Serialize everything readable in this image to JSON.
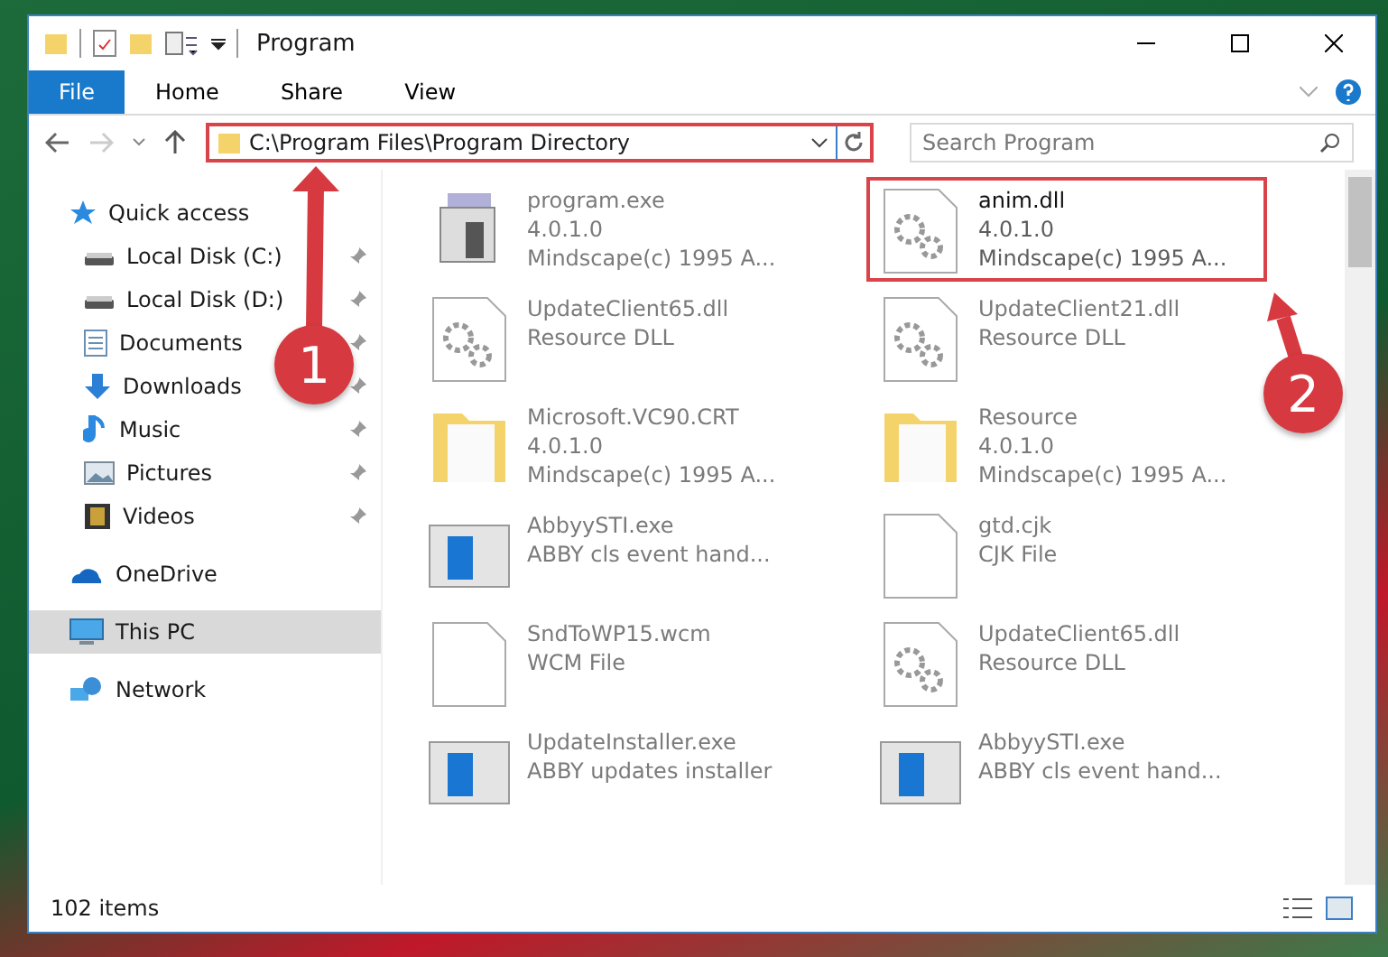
{
  "window": {
    "title": "Program"
  },
  "ribbon": {
    "file_tab": "File",
    "tabs": [
      "Home",
      "Share",
      "View"
    ]
  },
  "address": {
    "path": "C:\\Program Files\\Program Directory"
  },
  "search": {
    "placeholder": "Search Program"
  },
  "nav": [
    {
      "label": "Quick access",
      "kind": "star",
      "selected": false,
      "children": [
        {
          "label": "Local Disk (C:)",
          "kind": "drive",
          "selected": false,
          "pinned": true
        },
        {
          "label": "Local Disk (D:)",
          "kind": "drive",
          "selected": false,
          "pinned": true
        },
        {
          "label": "Documents",
          "kind": "document",
          "selected": false,
          "pinned": true
        },
        {
          "label": "Downloads",
          "kind": "download",
          "selected": false,
          "pinned": true
        },
        {
          "label": "Music",
          "kind": "music",
          "selected": false,
          "pinned": true
        },
        {
          "label": "Pictures",
          "kind": "picture",
          "selected": false,
          "pinned": true
        },
        {
          "label": "Videos",
          "kind": "video",
          "selected": false,
          "pinned": true
        }
      ]
    },
    {
      "label": "OneDrive",
      "kind": "cloud",
      "selected": false
    },
    {
      "label": "This PC",
      "kind": "computer",
      "selected": true
    },
    {
      "label": "Network",
      "kind": "network",
      "selected": false
    }
  ],
  "files": [
    {
      "kind": "app",
      "name": "program.exe",
      "details": [
        "4.0.1.0",
        "Mindscape(c) 1995 A..."
      ],
      "highlighted": false,
      "blurred": true
    },
    {
      "kind": "dll",
      "name": "anim.dll",
      "details": [
        "4.0.1.0",
        "Mindscape(c) 1995 A..."
      ],
      "highlighted": true,
      "blurred": false
    },
    {
      "kind": "dll",
      "name": "UpdateClient65.dll",
      "details": [
        "Resource DLL"
      ],
      "highlighted": false,
      "blurred": true
    },
    {
      "kind": "dll",
      "name": "UpdateClient21.dll",
      "details": [
        "Resource DLL"
      ],
      "highlighted": false,
      "blurred": true
    },
    {
      "kind": "folder",
      "name": "Microsoft.VC90.CRT",
      "details": [
        "4.0.1.0",
        "Mindscape(c) 1995 A..."
      ],
      "highlighted": false,
      "blurred": true
    },
    {
      "kind": "folder",
      "name": "Resource",
      "details": [
        "4.0.1.0",
        "Mindscape(c) 1995 A..."
      ],
      "highlighted": false,
      "blurred": true
    },
    {
      "kind": "window",
      "name": "AbbyySTI.exe",
      "details": [
        "ABBY cls event hand..."
      ],
      "highlighted": false,
      "blurred": true
    },
    {
      "kind": "blank",
      "name": "gtd.cjk",
      "details": [
        "CJK File"
      ],
      "highlighted": false,
      "blurred": true
    },
    {
      "kind": "blank",
      "name": "SndToWP15.wcm",
      "details": [
        "WCM File"
      ],
      "highlighted": false,
      "blurred": true
    },
    {
      "kind": "dll",
      "name": "UpdateClient65.dll",
      "details": [
        "Resource DLL"
      ],
      "highlighted": false,
      "blurred": true
    },
    {
      "kind": "window",
      "name": "UpdateInstaller.exe",
      "details": [
        "ABBY updates installer"
      ],
      "highlighted": false,
      "blurred": true
    },
    {
      "kind": "window",
      "name": "AbbyySTI.exe",
      "details": [
        "ABBY cls event hand..."
      ],
      "highlighted": false,
      "blurred": true
    }
  ],
  "status_bar": {
    "count": "102 items"
  },
  "annotations": [
    {
      "label": "1"
    },
    {
      "label": "2"
    }
  ]
}
